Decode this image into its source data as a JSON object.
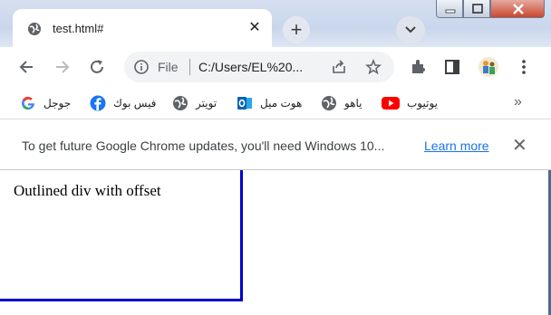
{
  "tab": {
    "title": "test.html#",
    "favicon": "globe-icon",
    "close_glyph": "✕"
  },
  "new_tab_glyph": "+",
  "toolbar": {
    "back_icon": "back-arrow-icon",
    "forward_icon": "forward-arrow-icon",
    "reload_icon": "reload-icon",
    "address": {
      "scheme_label": "File",
      "url": "C:/Users/EL%20..."
    }
  },
  "bookmarks": {
    "items": [
      {
        "label": "جوجل",
        "icon": "google-icon"
      },
      {
        "label": "فيس بوك",
        "icon": "facebook-icon"
      },
      {
        "label": "تويتر",
        "icon": "globe-icon"
      },
      {
        "label": "هوت ميل",
        "icon": "outlook-icon"
      },
      {
        "label": "ياهو",
        "icon": "globe-icon"
      },
      {
        "label": "يوتيوب",
        "icon": "youtube-icon"
      }
    ],
    "overflow_glyph": "»"
  },
  "infobar": {
    "message": "To get future Google Chrome updates, you'll need Windows 10...",
    "link": "Learn more",
    "close_glyph": "✕"
  },
  "page": {
    "outlined_text": "Outlined div with offset"
  },
  "colors": {
    "outline": "#0000cc",
    "link": "#1a73e8"
  }
}
